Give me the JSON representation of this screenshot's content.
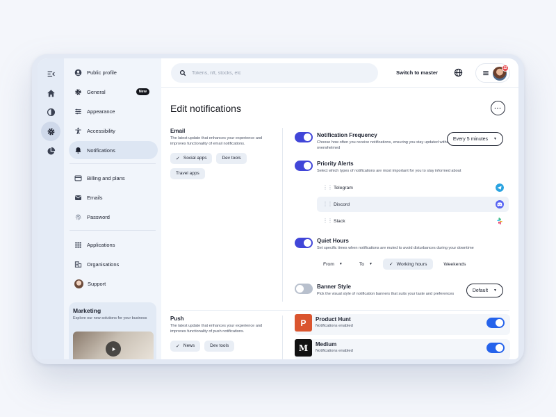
{
  "colors": {
    "accent": "#4146d8",
    "toggle_on_blue": "#2563eb",
    "product_hunt": "#da552f",
    "medium": "#111111",
    "telegram": "#2aa3e0",
    "discord": "#5865f2"
  },
  "rail": {
    "icons": [
      "collapse-icon",
      "home-icon",
      "contrast-icon",
      "gear-icon",
      "pie-chart-icon"
    ]
  },
  "sidebar": {
    "items": [
      {
        "label": "Public profile",
        "icon": "user-circle-icon"
      },
      {
        "label": "General",
        "icon": "gear-icon",
        "badge": "New"
      },
      {
        "label": "Appearance",
        "icon": "sliders-icon"
      },
      {
        "label": "Accessibility",
        "icon": "accessibility-icon"
      },
      {
        "label": "Notifications",
        "icon": "bell-icon"
      },
      {
        "label": "Billing and plans",
        "icon": "credit-card-icon"
      },
      {
        "label": "Emails",
        "icon": "mail-icon"
      },
      {
        "label": "Password",
        "icon": "fingerprint-icon"
      },
      {
        "label": "Applications",
        "icon": "grid-icon"
      },
      {
        "label": "Organisations",
        "icon": "building-icon"
      },
      {
        "label": "Support",
        "icon": "support-avatar"
      }
    ],
    "marketing": {
      "title": "Marketing",
      "text": "Explore our new solutions for your business"
    }
  },
  "header": {
    "search_placeholder": "Tokens, nft, stocks, etc",
    "switch_label": "Switch to master",
    "notification_count": "12"
  },
  "main": {
    "title": "Edit notifications",
    "email": {
      "title": "Email",
      "description": "The latest update that enhances your experience and improves functionality of email notifications.",
      "chips": [
        {
          "label": "Social apps",
          "selected": true
        },
        {
          "label": "Dev tools",
          "selected": false
        },
        {
          "label": "Travel apps",
          "selected": false
        }
      ]
    },
    "frequency": {
      "title": "Notification Frequency",
      "description": "Choose how often you receive notifications, ensuring you stay updated without being overwhelmed",
      "value": "Every 5 minutes",
      "enabled": true
    },
    "priority": {
      "title": "Priority Alerts",
      "description": "Select which types of notifications are most important for you to stay informed about",
      "enabled": true,
      "apps": [
        "Telegram",
        "Discord",
        "Slack"
      ]
    },
    "quiet": {
      "title": "Quiet Hours",
      "description": "Set specific times when notifications are muted to avoid disturbances during your downtime",
      "enabled": true,
      "from": "From",
      "to": "To",
      "working": "Working hours",
      "weekends": "Weekends"
    },
    "banner": {
      "title": "Banner Style",
      "description": "Pick the visual style of notification banners that suits your taste and preferences",
      "value": "Default",
      "enabled": false
    },
    "push": {
      "title": "Push",
      "description": "The latest update that enhances your experience and improves functionality of push notifications.",
      "chips": [
        {
          "label": "News",
          "selected": true
        },
        {
          "label": "Dev tools",
          "selected": false
        }
      ],
      "apps": [
        {
          "name": "Product Hunt",
          "status": "Notifications enabled",
          "logo": "P",
          "enabled": true
        },
        {
          "name": "Medium",
          "status": "Notifications enabled",
          "logo": "M",
          "enabled": true
        }
      ]
    }
  }
}
